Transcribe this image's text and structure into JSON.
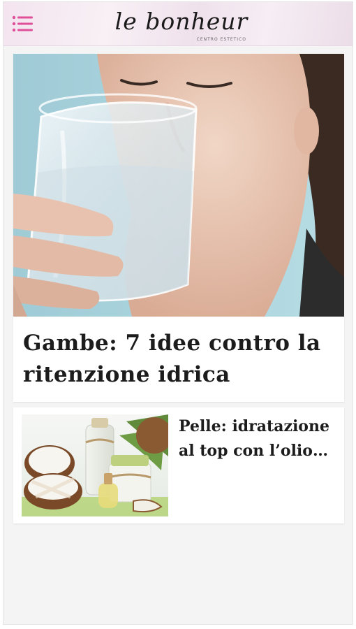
{
  "header": {
    "logo_text": "le bonheur",
    "logo_subtitle": "CENTRO ESTETICO",
    "menu_icon": "hamburger-menu-icon",
    "accent_color": "#e0509a"
  },
  "articles": [
    {
      "title": "Gambe: 7 idee contro la ritenzione idrica",
      "image_icon": "woman-drinking-water-photo"
    },
    {
      "title": "Pelle: idratazione al top con l’olio…",
      "image_icon": "coconut-oil-photo"
    }
  ]
}
